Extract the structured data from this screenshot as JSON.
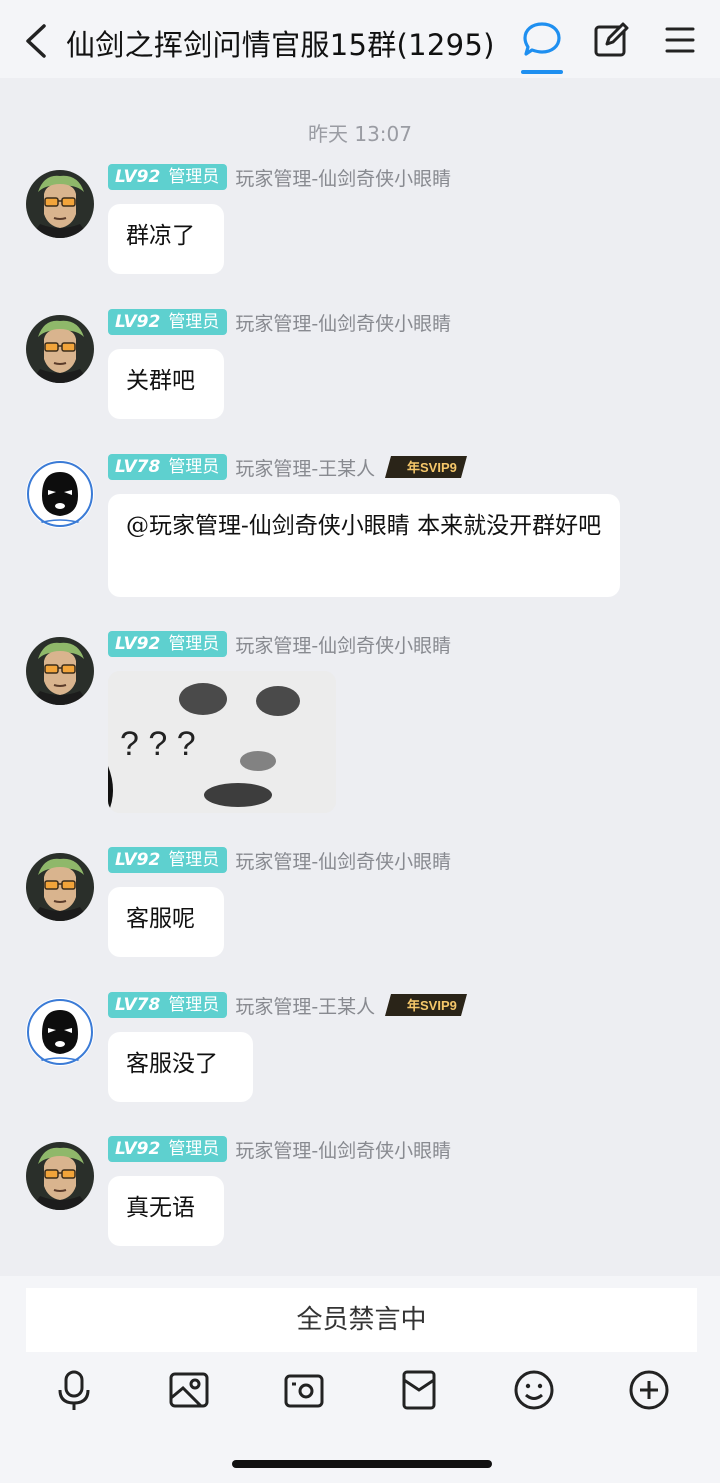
{
  "header": {
    "title": "仙剑之挥剑问情官服15群(1295)"
  },
  "chat": {
    "timestamp": "昨天 13:07",
    "messages": [
      {
        "level": "LV92",
        "role": "管理员",
        "nick": "玩家管理-仙剑奇侠小眼睛",
        "avatar": "zoro-avatar",
        "text": "群凉了",
        "svip": false
      },
      {
        "level": "LV92",
        "role": "管理员",
        "nick": "玩家管理-仙剑奇侠小眼睛",
        "avatar": "zoro-avatar",
        "text": "关群吧",
        "svip": false
      },
      {
        "level": "LV78",
        "role": "管理员",
        "nick": "玩家管理-王某人",
        "avatar": "masked-avatar",
        "text": "@玩家管理-仙剑奇侠小眼睛 本来就没开群好吧",
        "svip": true,
        "svip_label": "年SVIP9"
      },
      {
        "level": "LV92",
        "role": "管理员",
        "nick": "玩家管理-仙剑奇侠小眼睛",
        "avatar": "zoro-avatar",
        "image_text": "? ? ?",
        "svip": false
      },
      {
        "level": "LV92",
        "role": "管理员",
        "nick": "玩家管理-仙剑奇侠小眼睛",
        "avatar": "zoro-avatar",
        "text": "客服呢",
        "svip": false
      },
      {
        "level": "LV78",
        "role": "管理员",
        "nick": "玩家管理-王某人",
        "avatar": "masked-avatar",
        "text": "客服没了",
        "svip": true,
        "svip_label": "年SVIP9"
      },
      {
        "level": "LV92",
        "role": "管理员",
        "nick": "玩家管理-仙剑奇侠小眼睛",
        "avatar": "zoro-avatar",
        "text": "真无语",
        "svip": false
      }
    ]
  },
  "input": {
    "mute_label": "全员禁言中"
  },
  "toolbar": [
    "mic-icon",
    "image-icon",
    "camera-icon",
    "red-packet-icon",
    "emoji-icon",
    "plus-icon"
  ],
  "colors": {
    "accent": "#1E8FF0",
    "badge": "#5ED0CF",
    "background": "#EDEEF2"
  }
}
